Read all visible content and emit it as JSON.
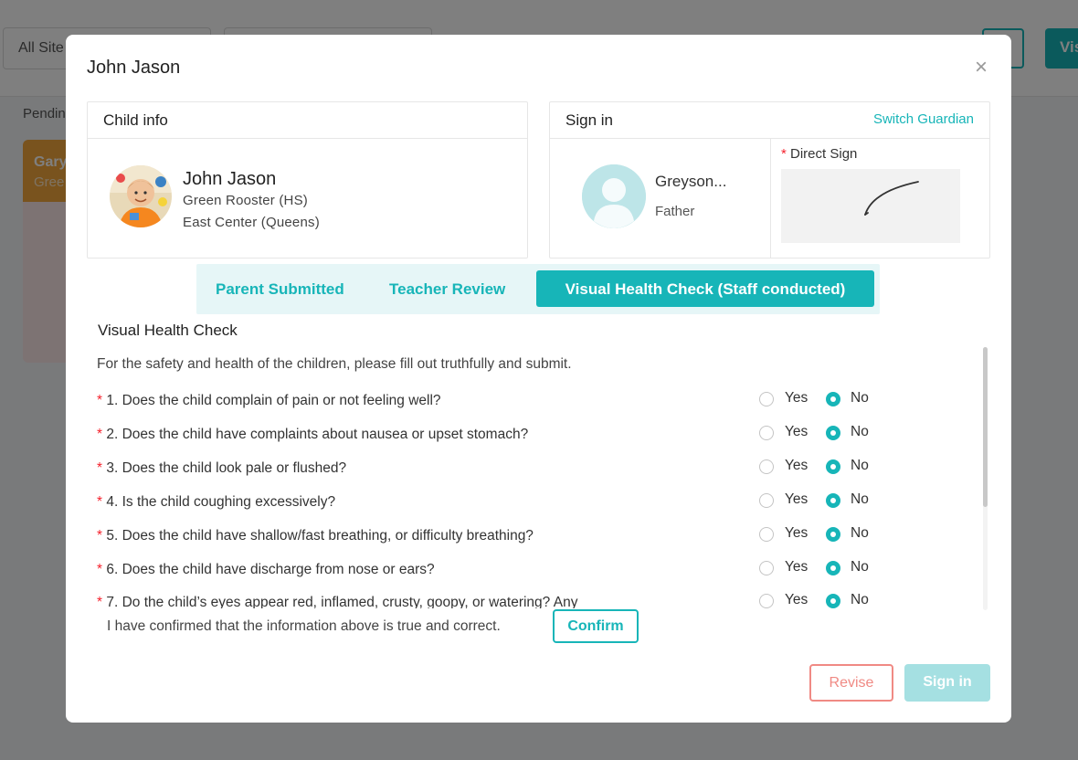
{
  "background": {
    "site_filter": "All Site",
    "second_filter": "",
    "visit_button": "Vis",
    "pending_label": "Pendin",
    "card_name": "Gary",
    "card_sub": "Gree"
  },
  "modal": {
    "title": "John Jason",
    "close_icon": "×"
  },
  "child_info": {
    "heading": "Child info",
    "name": "John Jason",
    "class": "Green Rooster (HS)",
    "center": "East Center (Queens)"
  },
  "sign_in": {
    "heading": "Sign in",
    "switch_link": "Switch Guardian",
    "guardian_name": "Greyson...",
    "guardian_relation": "Father",
    "direct_sign_required": "*",
    "direct_sign_label": "Direct Sign"
  },
  "tabs": [
    {
      "label": "Parent Submitted",
      "active": false
    },
    {
      "label": "Teacher Review",
      "active": false
    },
    {
      "label": "Visual Health Check (Staff conducted)",
      "active": true
    }
  ],
  "health_check": {
    "title": "Visual Health Check",
    "intro": "For the safety and health of the children, please fill out truthfully and submit.",
    "required_mark": "*",
    "yes_label": "Yes",
    "no_label": "No",
    "questions": [
      {
        "text": "1. Does the child complain of pain or not feeling well?",
        "answer": "No"
      },
      {
        "text": "2. Does the child have complaints about nausea or upset stomach?",
        "answer": "No"
      },
      {
        "text": "3. Does the child look pale or flushed?",
        "answer": "No"
      },
      {
        "text": "4. Is the child coughing excessively?",
        "answer": "No"
      },
      {
        "text": "5. Does the child have shallow/fast breathing, or difficulty breathing?",
        "answer": "No"
      },
      {
        "text": "6. Does the child have discharge from nose or ears?",
        "answer": "No"
      },
      {
        "text": "7. Do the child’s eyes appear red, inflamed, crusty, goopy, or watering? Any",
        "answer": "No"
      }
    ],
    "confirm_text": "I have confirmed that the information above is true and correct.",
    "confirm_button": "Confirm"
  },
  "footer": {
    "revise_button": "Revise",
    "signin_button": "Sign in"
  },
  "colors": {
    "accent": "#17b5b8",
    "danger": "#f08a84",
    "disabled_accent": "#a5e0e2"
  }
}
